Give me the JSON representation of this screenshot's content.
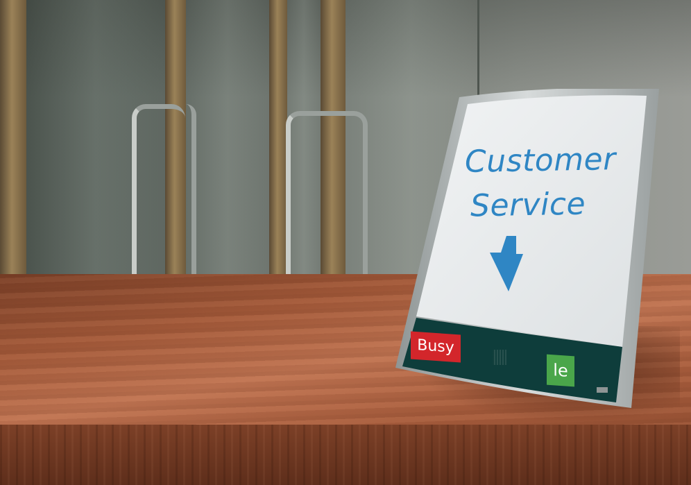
{
  "scene": {
    "description_type": "photo-realistic render",
    "colors": {
      "wall": "#6e756f",
      "counter": "#a45a3a",
      "door_frame": "#8a7350",
      "handle": "#a8aea9",
      "sign_face": "#e9ecee",
      "sign_frame": "#b7bcbc",
      "sign_text": "#2f86c4",
      "status_bar": "#0e3d3b",
      "busy": "#d3262b",
      "idle": "#4aa64a"
    }
  },
  "sign": {
    "line1": "Customer",
    "line2": "Service",
    "arrow_icon": "down-arrow-icon",
    "busy_label": "Busy",
    "idle_label": "le"
  }
}
